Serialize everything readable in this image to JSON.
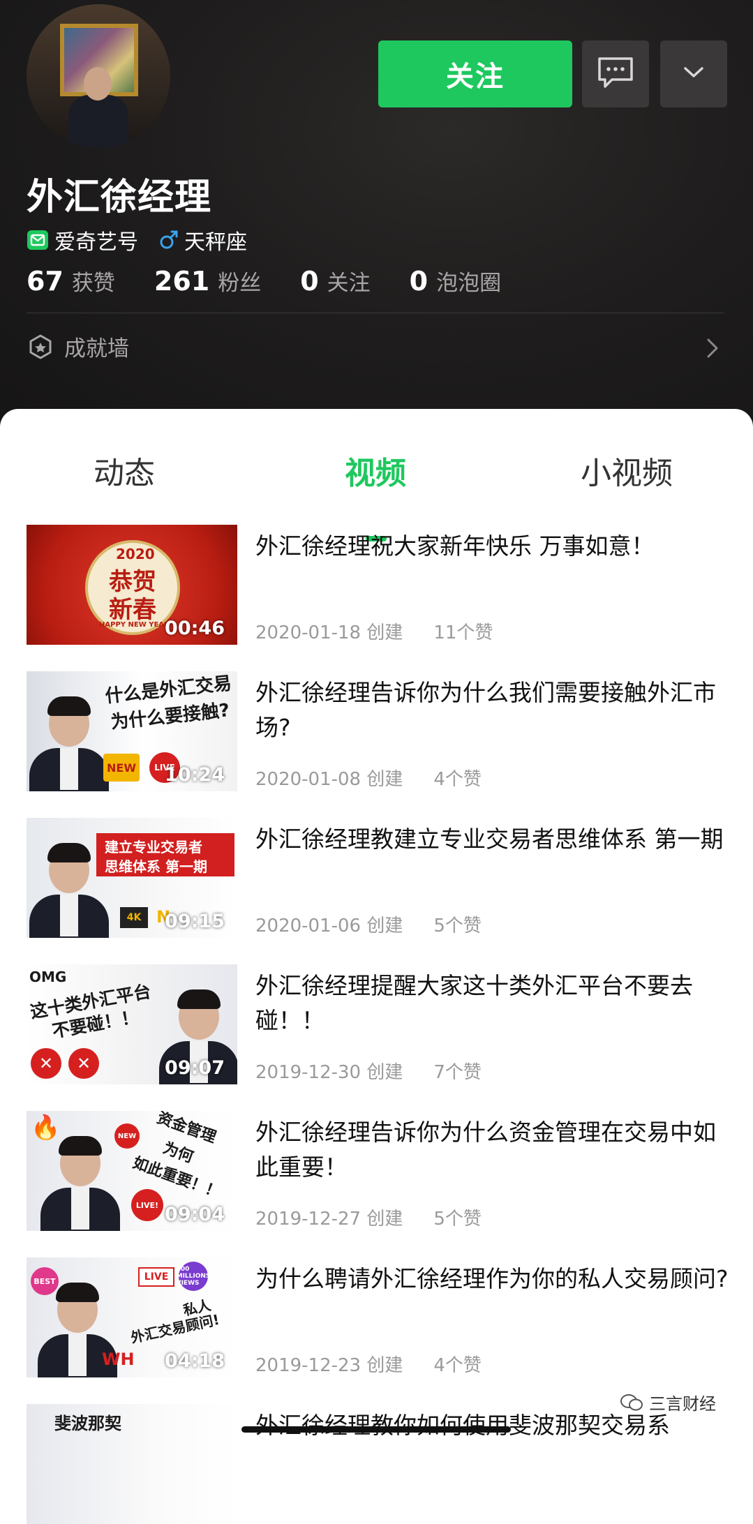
{
  "profile": {
    "name": "外汇徐经理",
    "follow_label": "关注",
    "tags": [
      "爱奇艺号",
      "天秤座"
    ],
    "stats": [
      {
        "num": "67",
        "label": "获赞"
      },
      {
        "num": "261",
        "label": "粉丝"
      },
      {
        "num": "0",
        "label": "关注"
      },
      {
        "num": "0",
        "label": "泡泡圈"
      }
    ],
    "achievements_label": "成就墙"
  },
  "tabs": [
    "动态",
    "视频",
    "小视频"
  ],
  "active_tab": "视频",
  "videos": [
    {
      "title": "外汇徐经理祝大家新年快乐 万事如意！",
      "date": "2020-01-18 创建",
      "likes": "11个赞",
      "duration": "00:46",
      "thumb_text": [
        "2020",
        "恭贺",
        "新春",
        "HAPPY NEW YEAR"
      ]
    },
    {
      "title": "外汇徐经理告诉你为什么我们需要接触外汇市场?",
      "date": "2020-01-08 创建",
      "likes": "4个赞",
      "duration": "10:24",
      "thumb_text": [
        "什么是外汇交易",
        "为什么要接触?",
        "NEW",
        "LIVE"
      ]
    },
    {
      "title": "外汇徐经理教建立专业交易者思维体系 第一期",
      "date": "2020-01-06 创建",
      "likes": "5个赞",
      "duration": "09:15",
      "thumb_text": [
        "建立专业交易者",
        "思维体系 第一期",
        "4K",
        "N"
      ]
    },
    {
      "title": "外汇徐经理提醒大家这十类外汇平台不要去碰！！",
      "date": "2019-12-30 创建",
      "likes": "7个赞",
      "duration": "09:07",
      "thumb_text": [
        "OMG",
        "这十类外汇平台",
        "不要碰！！"
      ]
    },
    {
      "title": "外汇徐经理告诉你为什么资金管理在交易中如此重要！",
      "date": "2019-12-27 创建",
      "likes": "5个赞",
      "duration": "09:04",
      "thumb_text": [
        "资金管理",
        "为何",
        "如此重要！！",
        "NEW",
        "LIVE!"
      ]
    },
    {
      "title": "为什么聘请外汇徐经理作为你的私人交易顾问?",
      "date": "2019-12-23 创建",
      "likes": "4个赞",
      "duration": "04:18",
      "thumb_text": [
        "BEST",
        "LIVE",
        "100 MILLIONS VIEWS",
        "私人",
        "外汇交易顾问!",
        "WH"
      ]
    },
    {
      "title": "外汇徐经理教你如何使用斐波那契交易系",
      "date": "",
      "likes": "",
      "duration": "",
      "thumb_text": [
        "斐波那契"
      ]
    }
  ],
  "watermark": "三言财经",
  "colors": {
    "accent": "#1ec85e",
    "header_bg": "#1c1b1b",
    "muted": "#9a9a9a"
  },
  "icons": [
    "message-icon",
    "chevron-down-icon",
    "iqiyi-badge-icon",
    "male-icon",
    "hexagon-icon",
    "chevron-right-icon",
    "wechat-icon"
  ]
}
